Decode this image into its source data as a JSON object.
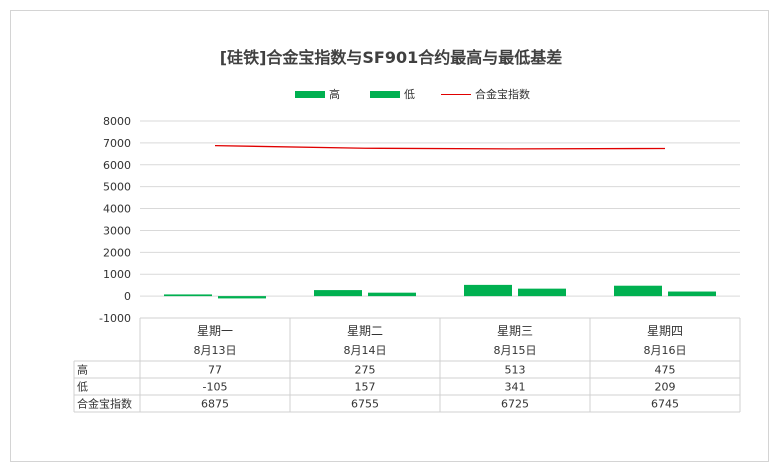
{
  "chart_data": {
    "type": "bar",
    "title": "[硅铁]合金宝指数与SF901合约最高与最低基差",
    "categories": [
      "星期一",
      "星期二",
      "星期三",
      "星期四"
    ],
    "dates": [
      "8月13日",
      "8月14日",
      "8月15日",
      "8月16日"
    ],
    "series": [
      {
        "name": "高",
        "type": "bar",
        "color": "#00b050",
        "values": [
          77,
          275,
          513,
          475
        ]
      },
      {
        "name": "低",
        "type": "bar",
        "color": "#00b050",
        "values": [
          -105,
          157,
          341,
          209
        ]
      },
      {
        "name": "合金宝指数",
        "type": "line",
        "color": "#e00000",
        "values": [
          6875,
          6755,
          6725,
          6745
        ]
      }
    ],
    "ylim": [
      -1000,
      8000
    ],
    "yticks": [
      "8000",
      "7000",
      "6000",
      "5000",
      "4000",
      "3000",
      "2000",
      "1000",
      "0",
      "-1000"
    ],
    "grid": true,
    "legend": "top",
    "table_row_labels": [
      "高",
      "低",
      "合金宝指数"
    ]
  }
}
